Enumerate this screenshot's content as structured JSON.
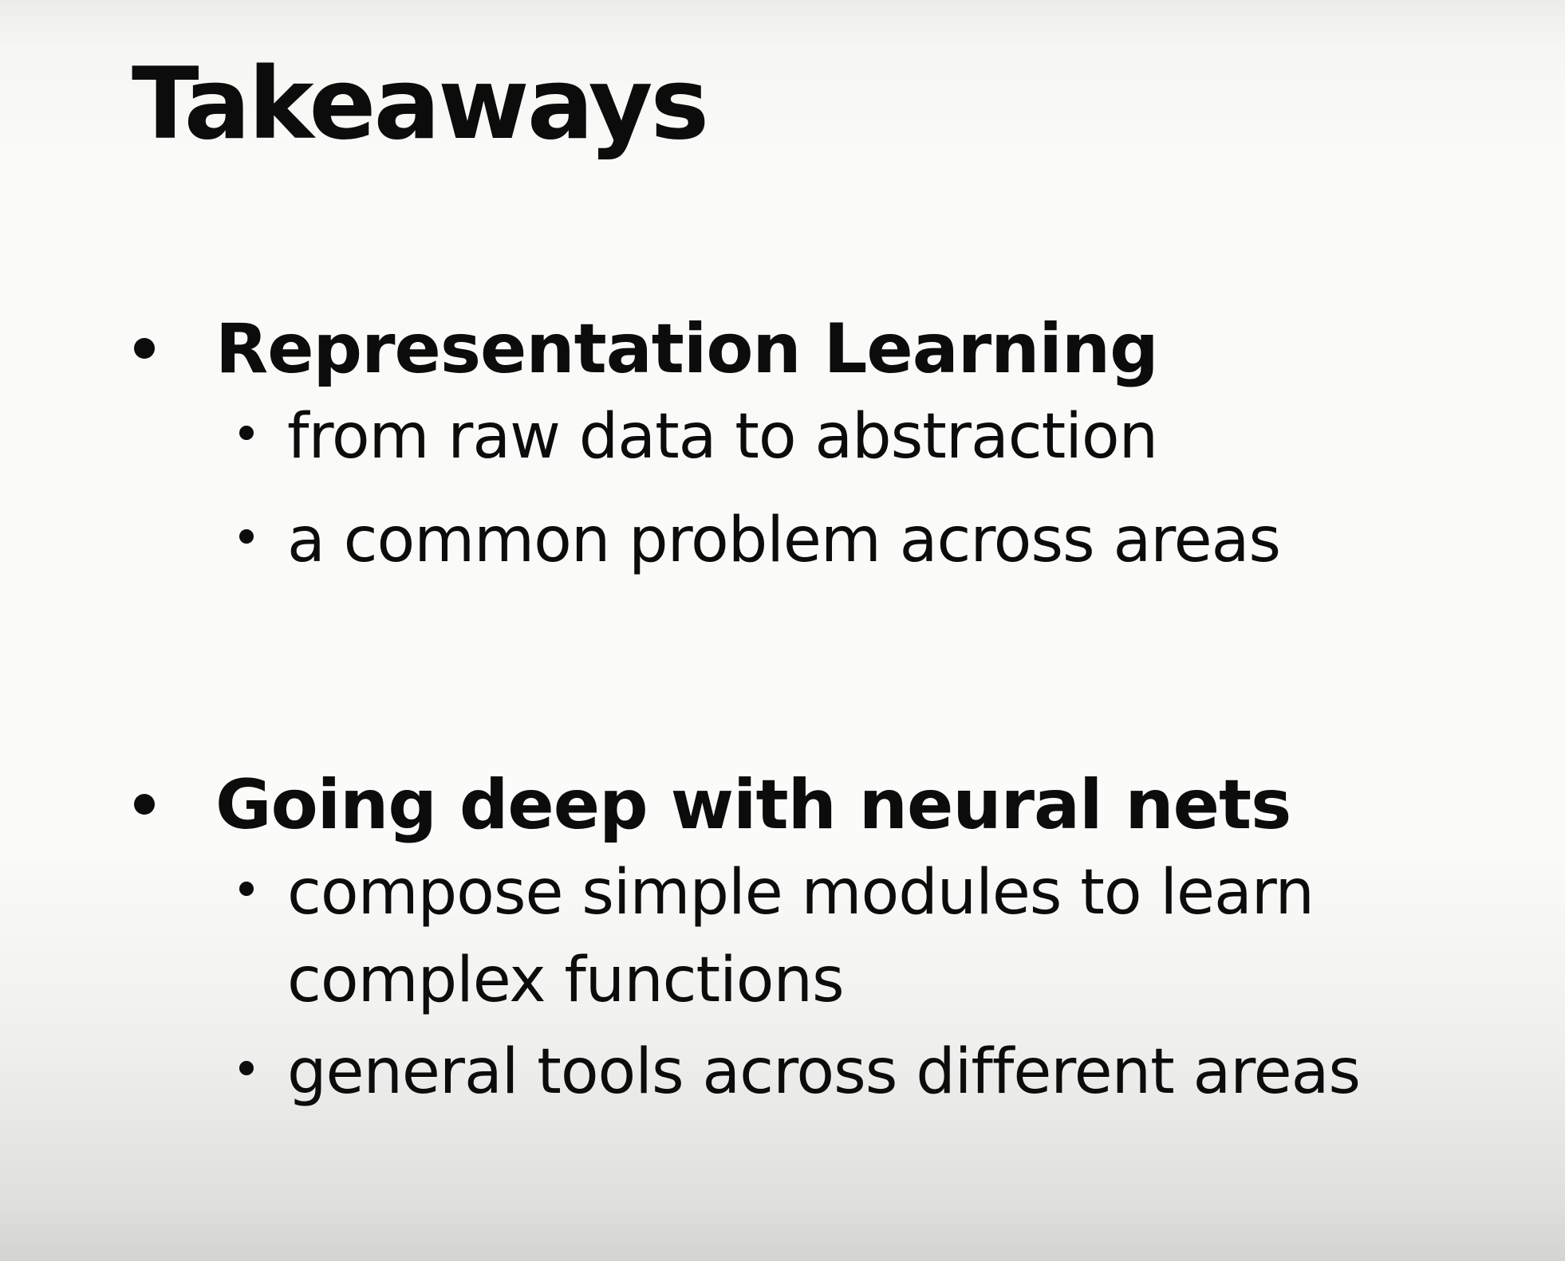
{
  "slide": {
    "title": "Takeaways",
    "sections": [
      {
        "heading": "Representation Learning",
        "points": [
          "from raw data to abstraction",
          "a common problem across areas"
        ]
      },
      {
        "heading": "Going deep with neural nets",
        "points": [
          "compose simple modules to learn complex functions",
          "general tools across different areas"
        ]
      }
    ]
  }
}
